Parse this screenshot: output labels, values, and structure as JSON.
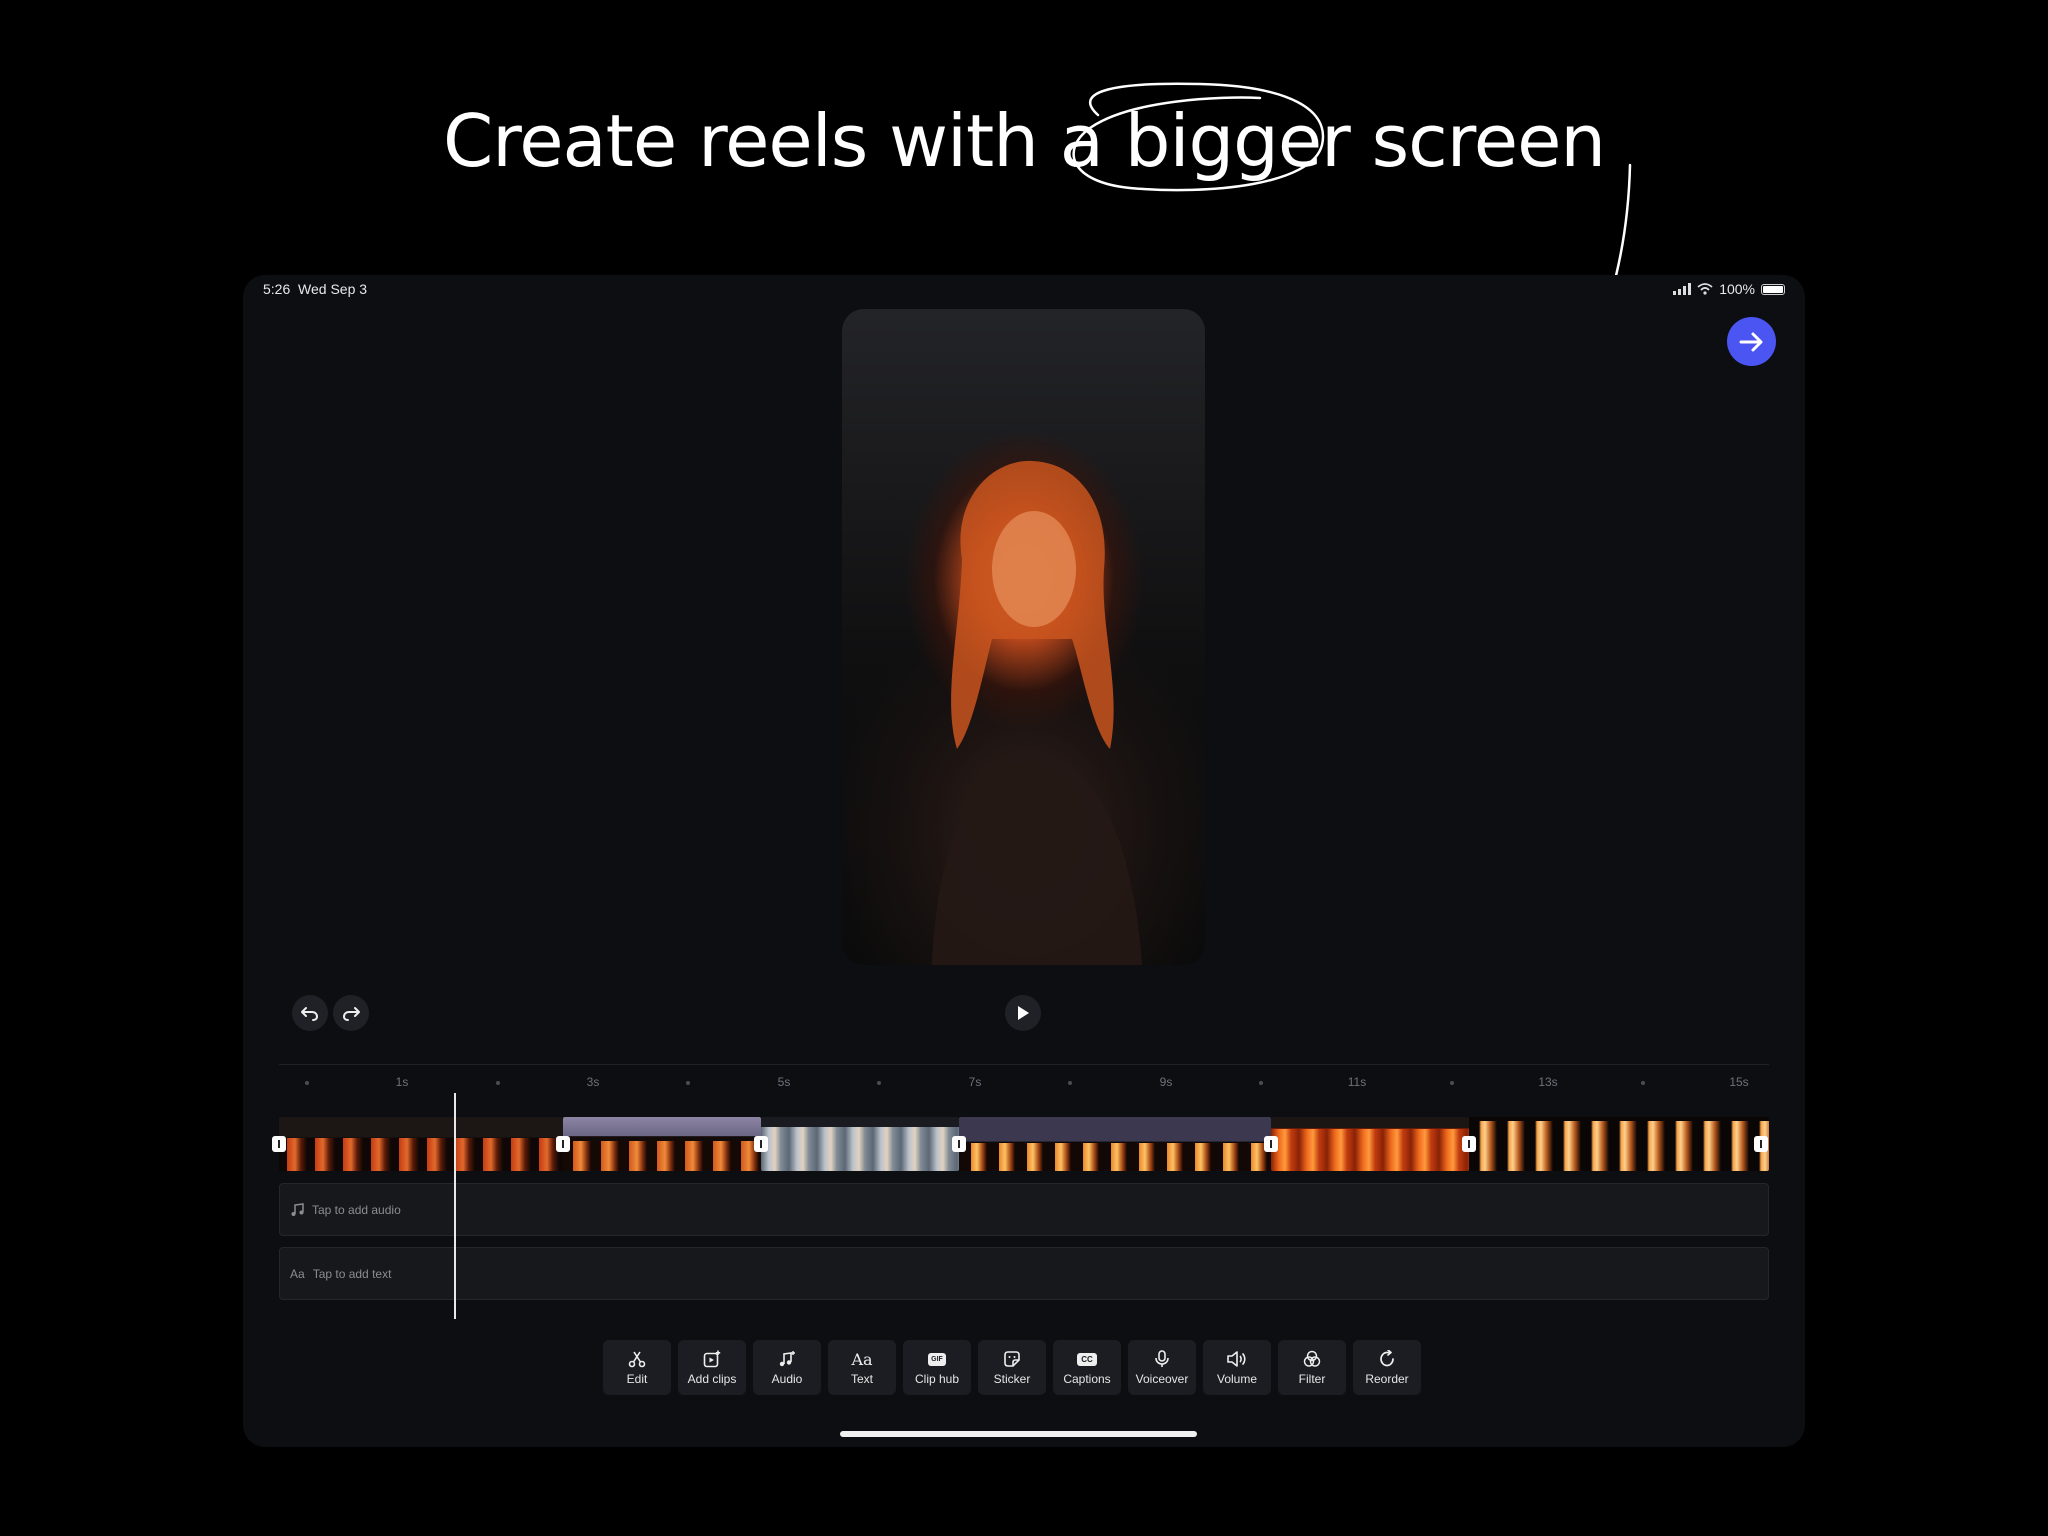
{
  "headline": {
    "before": "Create reels with a ",
    "highlight": "bigger",
    "after": " screen"
  },
  "status_bar": {
    "time": "5:26",
    "date": "Wed Sep 3",
    "battery": "100%"
  },
  "ruler": {
    "labels": [
      "1s",
      "3s",
      "5s",
      "7s",
      "9s",
      "11s",
      "13s",
      "15s"
    ]
  },
  "tracks": {
    "audio_placeholder": "Tap to add audio",
    "text_placeholder": "Tap to add text",
    "text_icon_glyph": "Aa"
  },
  "toolbar": {
    "items": [
      {
        "label": "Edit",
        "icon": "scissors-icon"
      },
      {
        "label": "Add clips",
        "icon": "add-clips-icon"
      },
      {
        "label": "Audio",
        "icon": "music-note-icon"
      },
      {
        "label": "Text",
        "icon": "text-aa-icon",
        "glyph": "Aa"
      },
      {
        "label": "Clip hub",
        "icon": "gif-icon",
        "glyph": "GIF"
      },
      {
        "label": "Sticker",
        "icon": "sticker-icon"
      },
      {
        "label": "Captions",
        "icon": "captions-icon",
        "glyph": "CC"
      },
      {
        "label": "Voiceover",
        "icon": "microphone-icon"
      },
      {
        "label": "Volume",
        "icon": "speaker-icon"
      },
      {
        "label": "Filter",
        "icon": "filter-icon"
      },
      {
        "label": "Reorder",
        "icon": "reorder-icon"
      }
    ]
  },
  "colors": {
    "accent": "#4a55f2",
    "background": "#0c0e12"
  }
}
